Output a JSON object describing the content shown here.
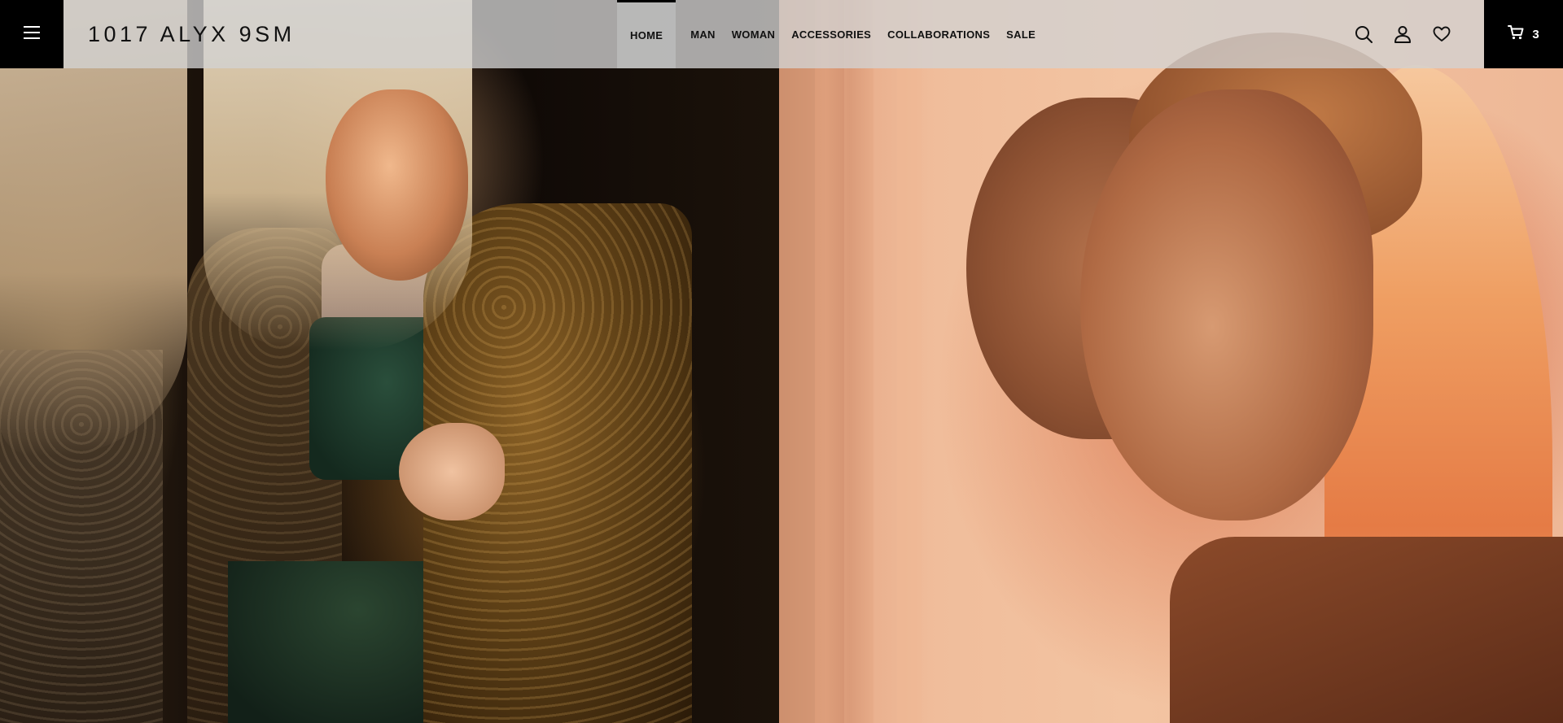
{
  "header": {
    "menu_icon": "hamburger-menu-icon",
    "logo": "1017 ALYX 9SM",
    "nav": [
      {
        "label": "HOME",
        "active": true
      },
      {
        "label": "MAN",
        "active": false
      },
      {
        "label": "WOMAN",
        "active": false
      },
      {
        "label": "ACCESSORIES",
        "active": false
      },
      {
        "label": "COLLABORATIONS",
        "active": false
      },
      {
        "label": "SALE",
        "active": false
      }
    ],
    "icons": [
      "search-icon",
      "account-icon",
      "wishlist-heart-icon"
    ],
    "cart": {
      "icon": "cart-icon",
      "count": "3"
    }
  },
  "hero": {
    "left_image": "model in crocodile-textured leather jacket with green top",
    "right_image": "model in profile with layered reflections, peach background"
  },
  "colors": {
    "header_bg": "#d2d2d2",
    "black": "#000000",
    "right_bg": "#f0bd9b"
  }
}
